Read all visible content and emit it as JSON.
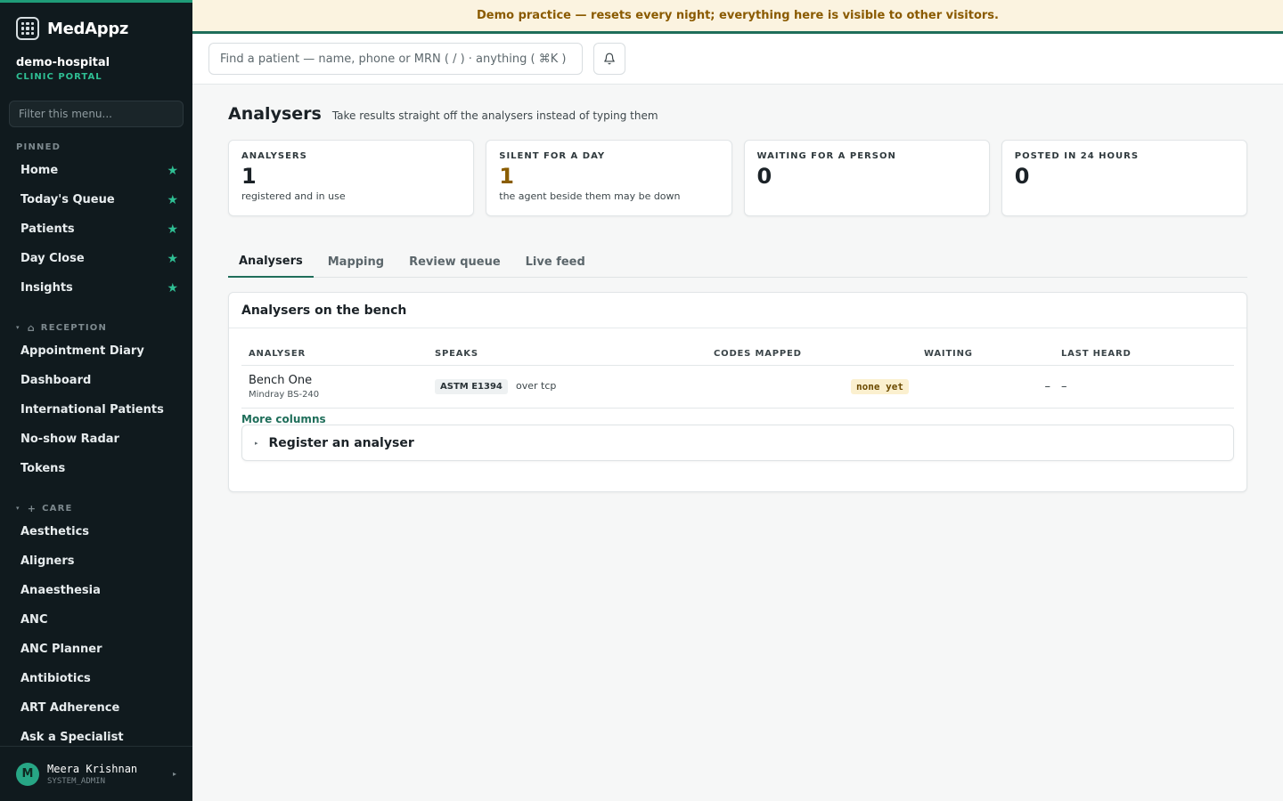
{
  "brand": {
    "name": "MedAppz"
  },
  "org": {
    "name": "demo-hospital",
    "subtitle": "CLINIC PORTAL"
  },
  "sidebar": {
    "filter_placeholder": "Filter this menu...",
    "pinned_title": "PINNED",
    "pinned": [
      {
        "label": "Home"
      },
      {
        "label": "Today's Queue"
      },
      {
        "label": "Patients"
      },
      {
        "label": "Day Close"
      },
      {
        "label": "Insights"
      }
    ],
    "reception_title": "RECEPTION",
    "reception": [
      {
        "label": "Appointment Diary"
      },
      {
        "label": "Dashboard"
      },
      {
        "label": "International Patients"
      },
      {
        "label": "No-show Radar"
      },
      {
        "label": "Tokens"
      }
    ],
    "care_title": "CARE",
    "care": [
      {
        "label": "Aesthetics"
      },
      {
        "label": "Aligners"
      },
      {
        "label": "Anaesthesia"
      },
      {
        "label": "ANC"
      },
      {
        "label": "ANC Planner"
      },
      {
        "label": "Antibiotics"
      },
      {
        "label": "ART Adherence"
      },
      {
        "label": "Ask a Specialist"
      }
    ]
  },
  "user": {
    "initial": "M",
    "name": "Meera Krishnan",
    "role": "SYSTEM_ADMIN"
  },
  "banner": {
    "text": "Demo practice — resets every night; everything here is visible to other visitors."
  },
  "topbar": {
    "search_placeholder": "Find a patient — name, phone or MRN ( / ) · anything ( ⌘K )"
  },
  "page": {
    "title": "Analysers",
    "subtitle": "Take results straight off the analysers instead of typing them"
  },
  "stats": [
    {
      "label": "ANALYSERS",
      "value": "1",
      "note": "registered and in use"
    },
    {
      "label": "SILENT FOR A DAY",
      "value": "1",
      "note": "the agent beside them may be down"
    },
    {
      "label": "WAITING FOR A PERSON",
      "value": "0",
      "note": ""
    },
    {
      "label": "POSTED IN 24 HOURS",
      "value": "0",
      "note": ""
    }
  ],
  "tabs": [
    {
      "label": "Analysers"
    },
    {
      "label": "Mapping"
    },
    {
      "label": "Review queue"
    },
    {
      "label": "Live feed"
    }
  ],
  "panel": {
    "title": "Analysers on the bench",
    "columns": [
      "ANALYSER",
      "SPEAKS",
      "CODES MAPPED",
      "WAITING",
      "LAST HEARD"
    ],
    "rows": [
      {
        "name": "Bench One",
        "model": "Mindray BS-240",
        "protocol": "ASTM E1394",
        "transport": "over tcp",
        "codes_mapped": "none yet",
        "waiting": "–",
        "last_heard": "–"
      }
    ],
    "more_columns": "More columns",
    "register_label": "Register an analyser"
  },
  "colors": {
    "accent": "#1f6e5a",
    "sidebar_bg": "#101a1e",
    "pin_star": "#2fbf94",
    "banner_bg": "#fbf3e0",
    "warn": "#8a5d00"
  }
}
